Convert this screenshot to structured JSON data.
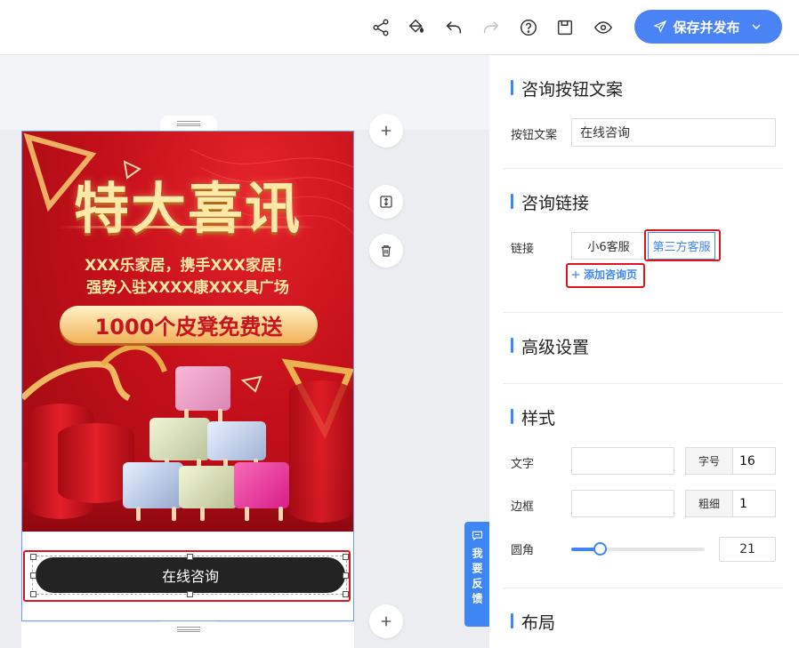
{
  "toolbar": {
    "icons": [
      "share-icon",
      "paint-bucket-icon",
      "undo-icon",
      "redo-icon",
      "help-icon",
      "save-icon",
      "preview-icon"
    ],
    "publish_label": "保存并发布"
  },
  "poster": {
    "title": "特大喜讯",
    "line1": "XXX乐家居，携手XXX家居！",
    "line2": "强势入驻XXXX康XXX具广场",
    "promo": "1000个皮凳免费送"
  },
  "cta_button": {
    "label": "在线咨询"
  },
  "feedback": {
    "label": "我要反馈"
  },
  "panel": {
    "section_button_text": {
      "title": "咨询按钮文案",
      "field_label": "按钮文案",
      "field_value": "在线咨询"
    },
    "section_link": {
      "title": "咨询链接",
      "field_label": "链接",
      "options": [
        "小6客服",
        "第三方客服"
      ],
      "selected": "第三方客服",
      "add_label": "添加咨询页"
    },
    "section_advanced": {
      "title": "高级设置"
    },
    "section_style": {
      "title": "样式",
      "text_label": "文字",
      "font_size_label": "字号",
      "font_size_value": "16",
      "border_label": "边框",
      "border_width_label": "粗细",
      "border_width_value": "1",
      "radius_label": "圆角",
      "radius_value": "21",
      "radius_slider_fraction": 0.21
    },
    "section_layout": {
      "title": "布局"
    }
  },
  "colors": {
    "accent": "#3f86f5",
    "highlight": "#e0141c",
    "cta_bg": "#232323"
  }
}
